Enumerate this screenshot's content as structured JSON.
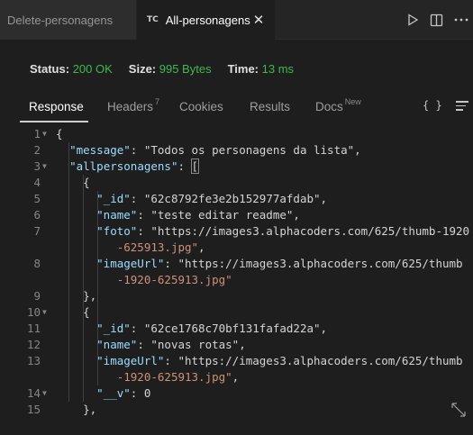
{
  "tabs": [
    {
      "label": "Delete-personagens",
      "active": false
    },
    {
      "label": "All-personagens",
      "active": true,
      "icon": "TC"
    }
  ],
  "status": {
    "status_label": "Status:",
    "status_value": "200 OK",
    "size_label": "Size:",
    "size_value": "995 Bytes",
    "time_label": "Time:",
    "time_value": "13 ms",
    "ok_color": "#3fb950"
  },
  "response_tabs": [
    {
      "label": "Response",
      "active": true
    },
    {
      "label": "Headers",
      "badge": "7"
    },
    {
      "label": "Cookies"
    },
    {
      "label": "Results"
    },
    {
      "label": "Docs",
      "badge": "New"
    }
  ],
  "icons": {
    "format": "{ }",
    "tab_icon": "TC"
  },
  "code_lines": [
    {
      "num": "1",
      "fold": true,
      "text": "{"
    },
    {
      "num": "2",
      "text": "  \"message\": \"Todos os personagens da lista\","
    },
    {
      "num": "3",
      "fold": true,
      "text": "  \"allpersonagens\": ["
    },
    {
      "num": "4",
      "text": "    {"
    },
    {
      "num": "5",
      "text": "      \"_id\": \"62c8792fe3e2b152977afdab\","
    },
    {
      "num": "6",
      "text": "      \"name\": \"teste editar readme\","
    },
    {
      "num": "7",
      "text": "      \"foto\": \"https://images3.alphacoders.com/625/thumb-1920"
    },
    {
      "num": "",
      "text": "         -625913.jpg\","
    },
    {
      "num": "8",
      "text": "      \"imageUrl\": \"https://images3.alphacoders.com/625/thumb"
    },
    {
      "num": "",
      "text": "         -1920-625913.jpg\""
    },
    {
      "num": "9",
      "text": "    },"
    },
    {
      "num": "10",
      "fold": true,
      "text": "    {"
    },
    {
      "num": "11",
      "text": "      \"_id\": \"62ce1768c70bf131fafad22a\","
    },
    {
      "num": "12",
      "text": "      \"name\": \"novas rotas\","
    },
    {
      "num": "13",
      "text": "      \"imageUrl\": \"https://images3.alphacoders.com/625/thumb"
    },
    {
      "num": "",
      "text": "         -1920-625913.jpg\","
    },
    {
      "num": "14",
      "fold": true,
      "text": "      \"__v\": 0"
    },
    {
      "num": "15",
      "text": "    },"
    }
  ]
}
